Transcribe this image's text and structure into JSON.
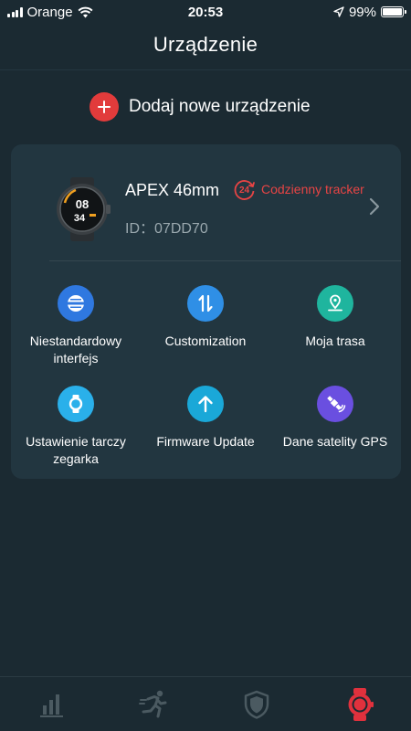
{
  "status_bar": {
    "carrier": "Orange",
    "time": "20:53",
    "battery": "99%",
    "battery_level": 0.99
  },
  "page": {
    "title": "Urządzenie"
  },
  "add_device": {
    "label": "Dodaj nowe urządzenie",
    "icon": "plus-icon"
  },
  "device": {
    "name": "APEX 46mm",
    "tracker_badge": "24",
    "tracker_label": "Codzienny tracker",
    "id_label": "ID：",
    "id_value": "07DD70",
    "watch_face_top": "08",
    "watch_face_bottom": "34"
  },
  "features": [
    {
      "label": "Niestandardowy interfejs",
      "icon": "custom-interface-icon",
      "color": "#2f78e0"
    },
    {
      "label": "Customization",
      "icon": "arrows-updown-icon",
      "color": "#2f8fe6"
    },
    {
      "label": "Moja trasa",
      "icon": "location-pin-icon",
      "color": "#1fb59e"
    },
    {
      "label": "Ustawienie tarczy zegarka",
      "icon": "watch-face-icon",
      "color": "#2ab0ea"
    },
    {
      "label": "Firmware Update",
      "icon": "arrow-up-icon",
      "color": "#1aa8d8"
    },
    {
      "label": "Dane satelity GPS",
      "icon": "satellite-icon",
      "color": "#6a4fe0"
    }
  ],
  "tabs": [
    {
      "icon": "stats-icon",
      "active": false
    },
    {
      "icon": "running-icon",
      "active": false
    },
    {
      "icon": "shield-icon",
      "active": false
    },
    {
      "icon": "watch-icon",
      "active": true
    }
  ],
  "colors": {
    "background": "#1b2a32",
    "card": "#223640",
    "accent_red": "#e23b3b",
    "tab_inactive": "#4b5a61"
  }
}
